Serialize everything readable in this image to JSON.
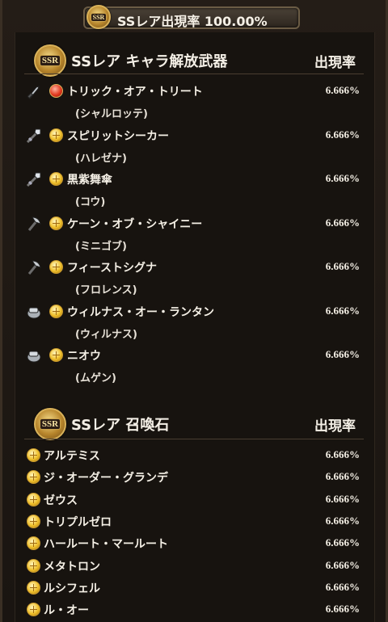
{
  "header": {
    "ssr_badge": "SSR",
    "summary": "SSレア出現率 100.00%"
  },
  "weapons_section": {
    "badge": "SSR",
    "title": "SSレア キャラ解放武器",
    "rate_label": "出現率",
    "items": [
      {
        "name": "トリック・オア・トリート",
        "character": "(シャルロッテ)",
        "rate": "6.666%",
        "element": "fire",
        "weapon_icon": "dagger-icon"
      },
      {
        "name": "スピリットシーカー",
        "character": "(ハレゼナ)",
        "rate": "6.666%",
        "element": "light",
        "weapon_icon": "spear-icon"
      },
      {
        "name": "黒紫舞傘",
        "character": "(コウ)",
        "rate": "6.666%",
        "element": "light",
        "weapon_icon": "spear-icon"
      },
      {
        "name": "ケーン・オブ・シャイニー",
        "character": "(ミニゴブ)",
        "rate": "6.666%",
        "element": "light",
        "weapon_icon": "axe-icon"
      },
      {
        "name": "フィーストシグナ",
        "character": "(フロレンス)",
        "rate": "6.666%",
        "element": "light",
        "weapon_icon": "axe-icon"
      },
      {
        "name": "ウィルナス・オー・ランタン",
        "character": "(ウィルナス)",
        "rate": "6.666%",
        "element": "light",
        "weapon_icon": "fist-icon"
      },
      {
        "name": "ニオウ",
        "character": "(ムゲン)",
        "rate": "6.666%",
        "element": "light",
        "weapon_icon": "fist-icon"
      }
    ]
  },
  "summons_section": {
    "badge": "SSR",
    "title": "SSレア 召喚石",
    "rate_label": "出現率",
    "items": [
      {
        "name": "アルテミス",
        "rate": "6.666%",
        "element": "light"
      },
      {
        "name": "ジ・オーダー・グランデ",
        "rate": "6.666%",
        "element": "light"
      },
      {
        "name": "ゼウス",
        "rate": "6.666%",
        "element": "light"
      },
      {
        "name": "トリプルゼロ",
        "rate": "6.666%",
        "element": "light"
      },
      {
        "name": "ハールート・マールート",
        "rate": "6.666%",
        "element": "light"
      },
      {
        "name": "メタトロン",
        "rate": "6.666%",
        "element": "light"
      },
      {
        "name": "ルシフェル",
        "rate": "6.666%",
        "element": "light"
      },
      {
        "name": "ル・オー",
        "rate": "6.666%",
        "element": "light"
      }
    ]
  },
  "colors": {
    "background": "#17130f",
    "text": "#f5f0e6",
    "gold": "#d9b25a"
  }
}
